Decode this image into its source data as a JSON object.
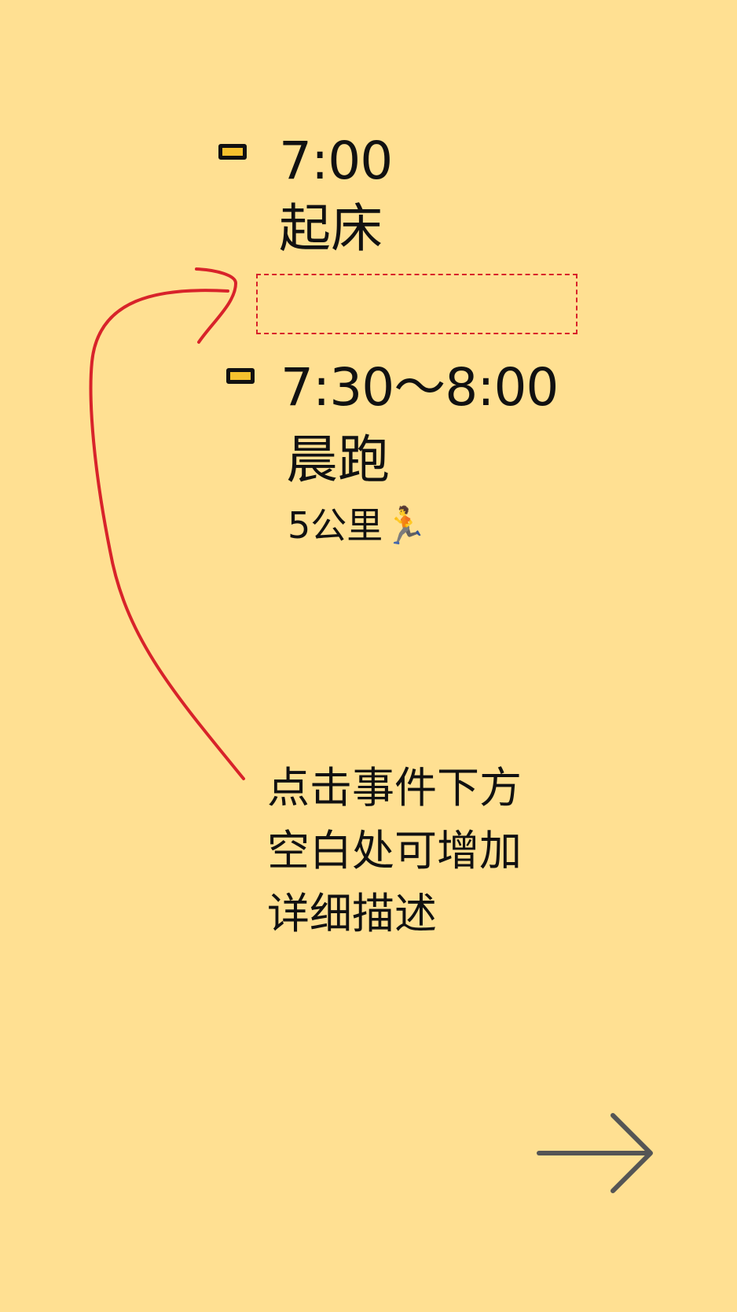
{
  "events": [
    {
      "time": "7:00",
      "title": "起床",
      "description": ""
    },
    {
      "time": "7:30～8:00",
      "title": "晨跑",
      "description": "5公里🏃"
    }
  ],
  "hint": {
    "lines": [
      "点击事件下方",
      "空白处可增加",
      "详细描述"
    ]
  },
  "colors": {
    "background": "#ffe092",
    "accent": "#d8232a",
    "marker_fill": "#f6c12e",
    "text": "#111111",
    "arrow_button": "#555555"
  },
  "icons": {
    "next": "arrow-right-icon",
    "marker": "event-marker-icon"
  }
}
